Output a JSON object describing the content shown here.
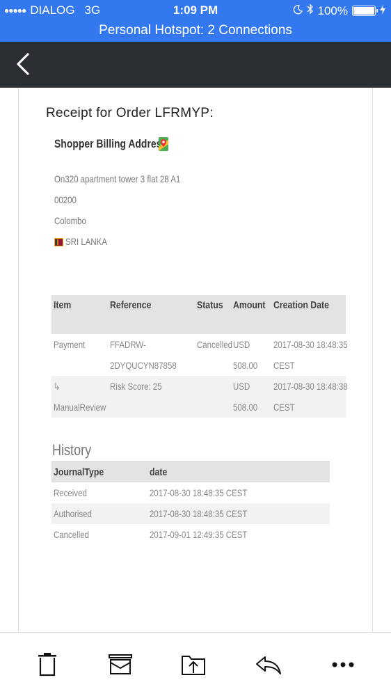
{
  "status_bar": {
    "signal_dots": "●●●●●",
    "carrier": "DIALOG",
    "network": "3G",
    "time": "1:09 PM",
    "battery": "100%",
    "icons": [
      "moon-icon",
      "bluetooth-icon",
      "battery-icon",
      "charging-icon"
    ]
  },
  "hotspot": {
    "text": "Personal Hotspot: 2 Connections"
  },
  "nav": {
    "back_icon": "chevron-left-icon"
  },
  "receipt": {
    "title": "Receipt for Order LFRMYP:",
    "billing_title": "Shopper Billing Address",
    "address_lines": [
      "On320 apartment tower 3 flat 28 A1",
      "00200",
      "Colombo"
    ],
    "country": "SRI LANKA"
  },
  "order_table": {
    "headers": [
      "Item",
      "Reference",
      "Status",
      "Amount",
      "Creation Date"
    ],
    "rows": [
      {
        "item": [
          "Payment",
          ""
        ],
        "reference": [
          "FFADRW-",
          "2DYQUCYN87858"
        ],
        "status": [
          "Cancelled",
          ""
        ],
        "amount": [
          "USD",
          "508.00"
        ],
        "date": [
          "2017-08-30 18:48:35",
          "CEST"
        ]
      },
      {
        "item": [
          "↳",
          "ManualReview"
        ],
        "reference": [
          "Risk Score: 25",
          ""
        ],
        "status": [
          "",
          ""
        ],
        "amount": [
          "USD",
          "508.00"
        ],
        "date": [
          "2017-08-30 18:48:38",
          "CEST"
        ]
      }
    ]
  },
  "history": {
    "title": "History",
    "headers": [
      "JournalType",
      "date"
    ],
    "rows": [
      {
        "type": "Received",
        "date": "2017-08-30 18:48:35 CEST"
      },
      {
        "type": "Authorised",
        "date": "2017-08-30 18:48:35 CEST"
      },
      {
        "type": "Cancelled",
        "date": "2017-09-01 12:49:35 CEST"
      }
    ]
  },
  "toolbar": {
    "icons": [
      "trash-icon",
      "archive-icon",
      "move-to-folder-icon",
      "reply-icon",
      "more-icon"
    ]
  },
  "colors": {
    "status_bar": "#3478f0",
    "nav_bar": "#2b2f33"
  }
}
